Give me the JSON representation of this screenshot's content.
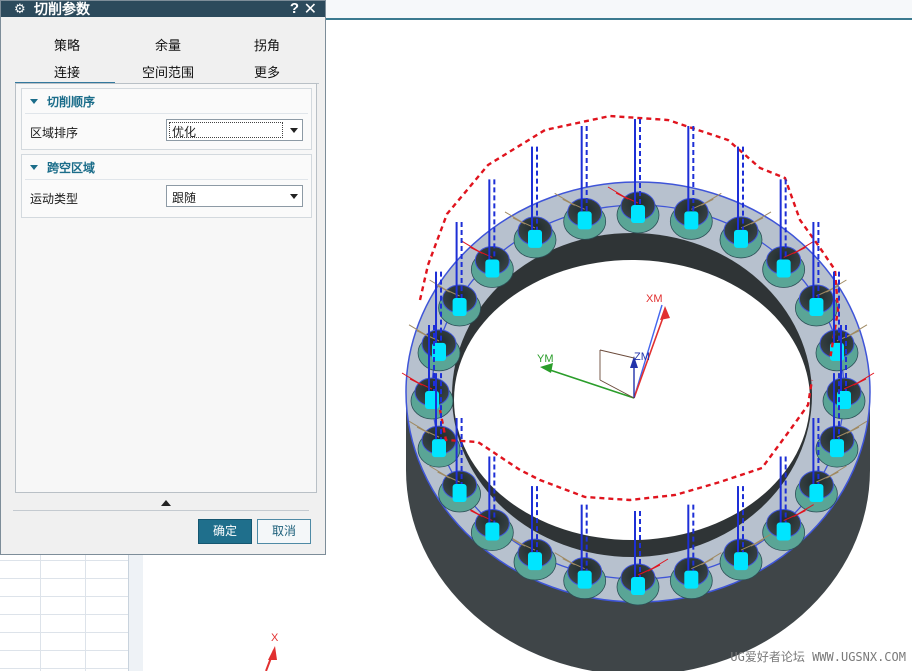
{
  "dialog": {
    "title": "切削参数",
    "help_icon": "?",
    "close_icon": "✕",
    "tabs_row1": [
      "策略",
      "余量",
      "拐角"
    ],
    "tabs_row2": [
      "连接",
      "空间范围",
      "更多"
    ],
    "active_tab": "连接",
    "groups": [
      {
        "title": "切削顺序",
        "field_label": "区域排序",
        "field_value": "优化"
      },
      {
        "title": "跨空区域",
        "field_label": "运动类型",
        "field_value": "跟随"
      }
    ],
    "ok_label": "确定",
    "cancel_label": "取消"
  },
  "viewport": {
    "axes": {
      "xm": "XM",
      "ym": "YM",
      "zm": "ZM",
      "x": "X"
    },
    "watermark": "UG爱好者论坛 WWW.UGSNX.COM"
  },
  "colors": {
    "accent": "#1f6f8c",
    "titlebar": "#2c4a5c",
    "part": "#b9c3d0",
    "toolpath_cut": "#00e5ff",
    "engage": "#1d2fd6",
    "rapid": "#e0141e"
  }
}
